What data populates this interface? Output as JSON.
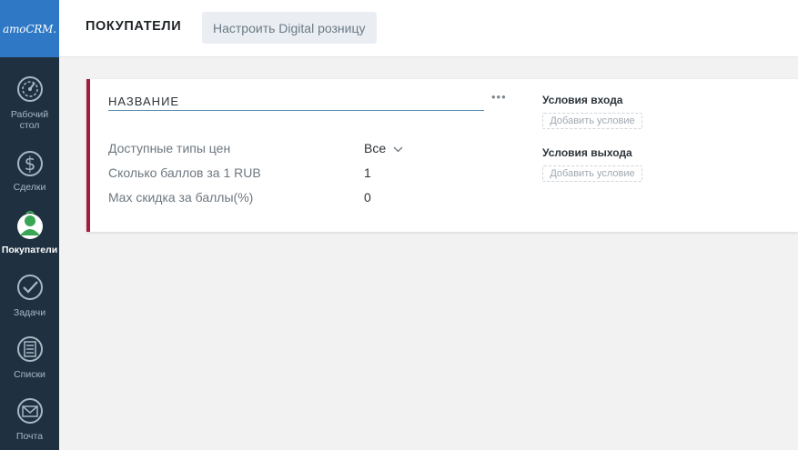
{
  "app": {
    "logo": "amoCRM."
  },
  "sidebar": {
    "items": [
      {
        "label": "Рабочий стол",
        "icon": "dashboard-gauge-icon",
        "active": false
      },
      {
        "label": "Сделки",
        "icon": "dollar-icon",
        "active": false
      },
      {
        "label": "Покупатели",
        "icon": "customers-icon",
        "active": true
      },
      {
        "label": "Задачи",
        "icon": "checkmark-icon",
        "active": false
      },
      {
        "label": "Списки",
        "icon": "list-icon",
        "active": false
      },
      {
        "label": "Почта",
        "icon": "mail-icon",
        "active": false
      }
    ]
  },
  "header": {
    "title": "ПОКУПАТЕЛИ",
    "configure_button": "Настроить Digital розницу"
  },
  "card": {
    "accent_color": "#a51a3f",
    "name_placeholder": "НАЗВАНИЕ",
    "more_label": "•••",
    "fields": [
      {
        "label": "Доступные типы цен",
        "value": "Все"
      },
      {
        "label": "Сколько баллов за 1 RUB",
        "value": "1"
      },
      {
        "label": "Max скидка за баллы(%)",
        "value": "0"
      }
    ],
    "entry_conditions": {
      "title": "Условия входа",
      "add_label": "Добавить условие"
    },
    "exit_conditions": {
      "title": "Условия выхода",
      "add_label": "Добавить условие"
    }
  },
  "colors": {
    "sidebar_bg": "#1f3140",
    "logo_bg": "#2e78c5",
    "active_icon_green": "#3aa655"
  }
}
